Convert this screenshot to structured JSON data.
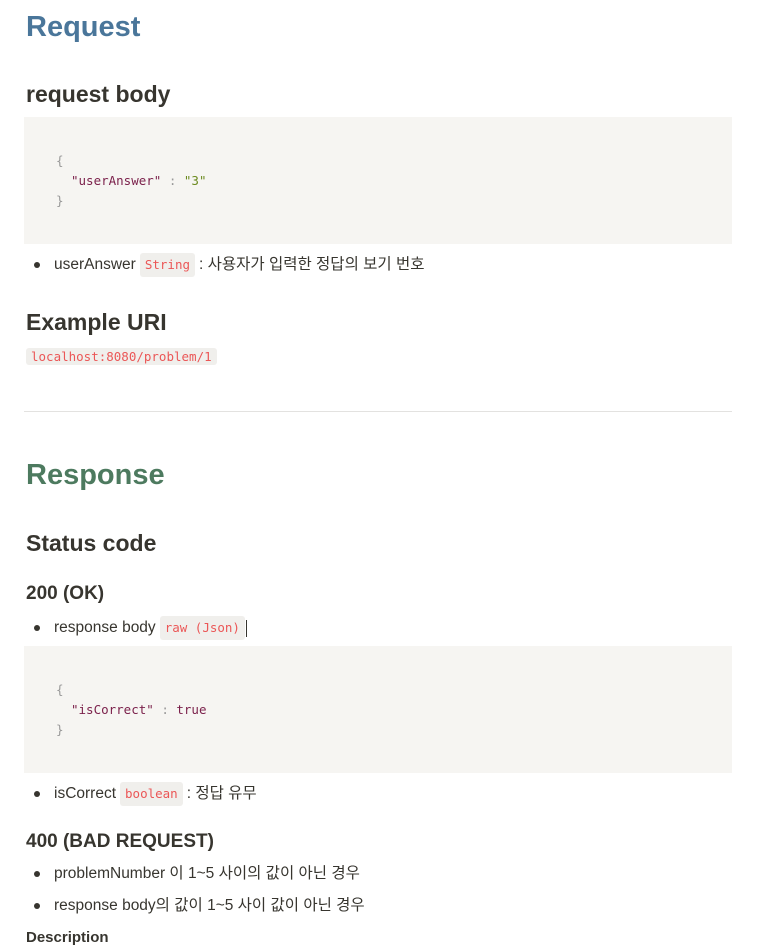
{
  "request": {
    "title": "Request",
    "body_heading": "request body",
    "code": {
      "open": "{",
      "key": "\"userAnswer\"",
      "sep": " : ",
      "value": "\"3\"",
      "close": "}"
    },
    "field": {
      "name": "userAnswer",
      "type": "String",
      "desc": ": 사용자가 입력한 정답의 보기 번호"
    },
    "example_heading": "Example URI",
    "example_uri": "localhost:8080/problem/1"
  },
  "response": {
    "title": "Response",
    "status_heading": "Status code",
    "ok": {
      "heading": "200 (OK)",
      "body_label": "response body",
      "body_type": "raw (Json)",
      "code": {
        "open": "{",
        "key": "\"isCorrect\"",
        "sep": " : ",
        "value": "true",
        "close": "}"
      },
      "field": {
        "name": "isCorrect",
        "type": "boolean",
        "desc": ": 정답 유무"
      }
    },
    "bad": {
      "heading": "400 (BAD REQUEST)",
      "items": [
        "problemNumber 이 1~5 사이의 값이 아닌 경우",
        "response body의 값이 1~5 사이 값이 아닌 경우"
      ]
    },
    "description_heading": "Description"
  }
}
